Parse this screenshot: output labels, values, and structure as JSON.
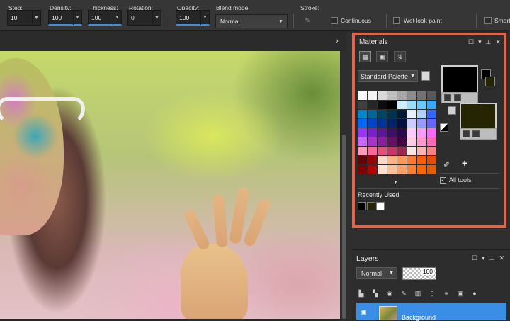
{
  "toolbar": {
    "step_label": "Step:",
    "step_value": "10",
    "density_label": "Density:",
    "density_value": "100",
    "thickness_label": "Thickness:",
    "thickness_value": "100",
    "rotation_label": "Rotation:",
    "rotation_value": "0",
    "opacity_label": "Opacity:",
    "opacity_value": "100",
    "blend_label": "Blend mode:",
    "blend_value": "Normal",
    "stroke_label": "Stroke:",
    "continuous_label": "Continuous",
    "wet_look_label": "Wet look paint",
    "smart_label": "Smart"
  },
  "materials": {
    "title": "Materials",
    "palette_label": "Standard Palette",
    "all_tools_label": "All tools",
    "all_tools_checked": true,
    "recently_used_label": "Recently Used",
    "foreground_color": "#000000",
    "background_color": "#252503",
    "swatches": [
      "#ffffff",
      "#f2f2f2",
      "#d9d9d9",
      "#bfbfbf",
      "#a6a6a6",
      "#8c8c8c",
      "#737373",
      "#595959",
      "#404040",
      "#262626",
      "#0d0d0d",
      "#000000",
      "#cceeff",
      "#99ddff",
      "#66ccff",
      "#33aaff",
      "#0088cc",
      "#006699",
      "#004466",
      "#00334d",
      "#001a33",
      "#e6f0ff",
      "#b3d1ff",
      "#3366ff",
      "#0066ff",
      "#0044cc",
      "#003399",
      "#002266",
      "#001144",
      "#ccccff",
      "#9999ff",
      "#6666ff",
      "#9933ff",
      "#7a1fcc",
      "#5c1799",
      "#3d0f66",
      "#2a0a4d",
      "#ffccff",
      "#ff99ff",
      "#ff66ff",
      "#cc66ff",
      "#aa33cc",
      "#882299",
      "#661166",
      "#440044",
      "#ffcce6",
      "#ff99cc",
      "#ff66b3",
      "#ff99bb",
      "#ff6699",
      "#e6507a",
      "#cc3366",
      "#99264d",
      "#ffe6e6",
      "#ffb3b3",
      "#ff8080",
      "#660000",
      "#990000",
      "#ffd9c2",
      "#ffb380",
      "#ff9955",
      "#ff7a33",
      "#ff5c0a",
      "#e64d00",
      "#800000",
      "#b30000",
      "#ffe0cc",
      "#ffc099",
      "#ffa066",
      "#ff8033",
      "#ff6600",
      "#e65c00"
    ],
    "recent": [
      "#000000",
      "#252503",
      "#ffffff"
    ]
  },
  "layers": {
    "title": "Layers",
    "blend_value": "Normal",
    "opacity_value": "100",
    "layer_name": "Background"
  },
  "colors": {
    "accent": "#3a8ee6",
    "highlight_border": "#e0664b"
  }
}
